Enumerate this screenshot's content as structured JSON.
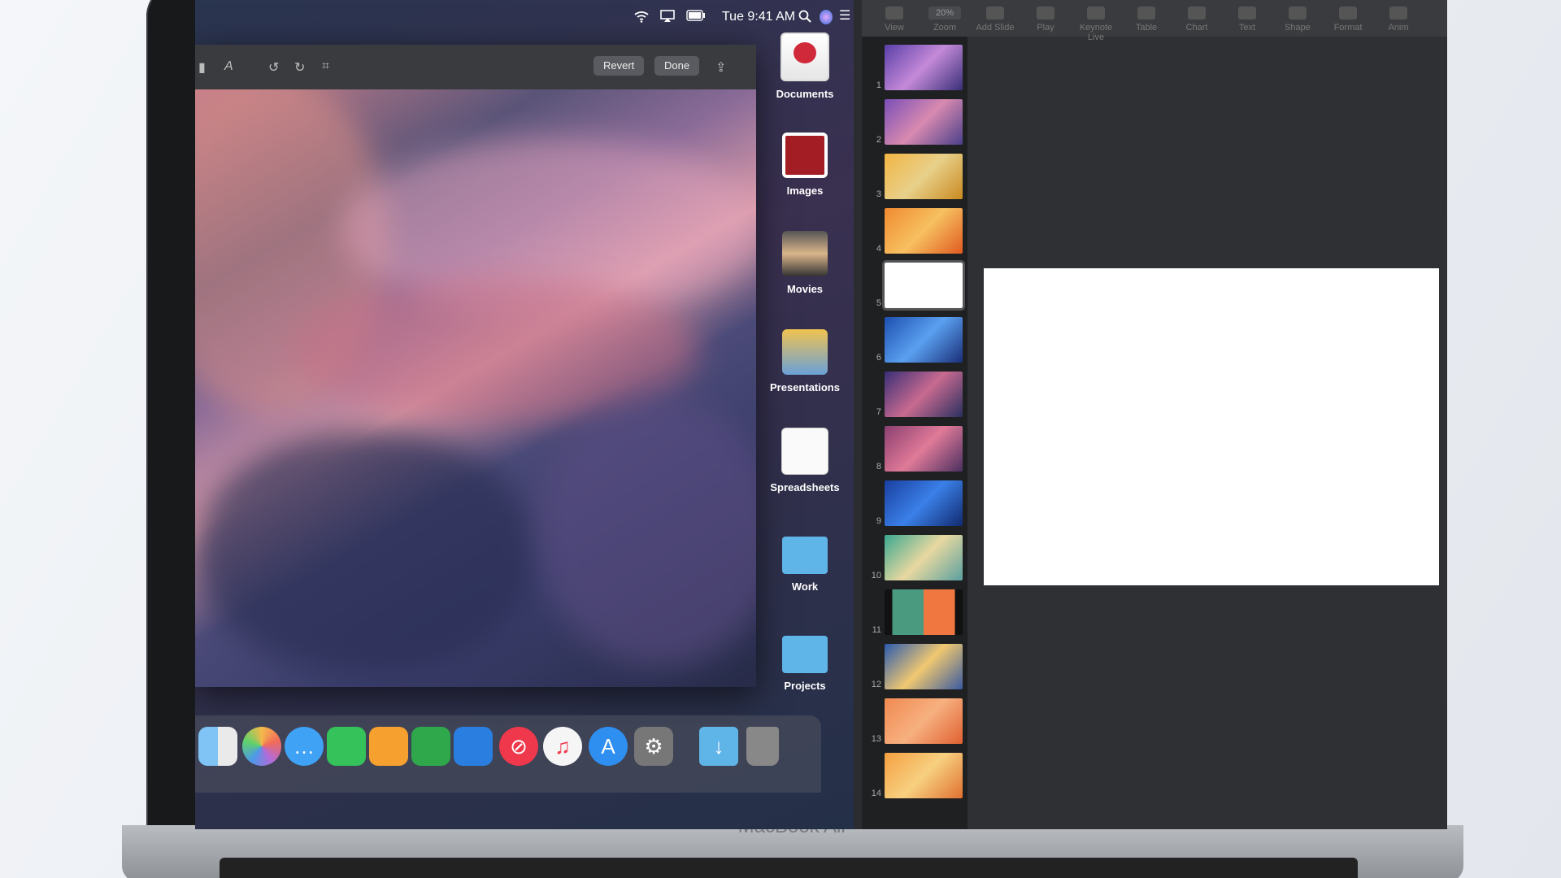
{
  "menubar": {
    "time": "Tue 9:41 AM",
    "icons": [
      "wifi-icon",
      "airplay-icon",
      "battery-icon",
      "search-icon",
      "siri-icon",
      "control-center-icon"
    ]
  },
  "editor": {
    "revert_label": "Revert",
    "done_label": "Done",
    "toolbar_icons": [
      "markup-icon",
      "text-style-icon",
      "rotate-left-icon",
      "rotate-right-icon",
      "crop-icon",
      "share-icon"
    ]
  },
  "stacks": [
    {
      "label": "Documents"
    },
    {
      "label": "Images"
    },
    {
      "label": "Movies"
    },
    {
      "label": "Presentations"
    },
    {
      "label": "Spreadsheets"
    },
    {
      "label": "Work"
    },
    {
      "label": "Projects"
    }
  ],
  "dock": {
    "apps": [
      "finder-icon",
      "photos-icon",
      "messages-icon",
      "facetime-icon",
      "pages-icon",
      "numbers-icon",
      "keynote-icon",
      "news-icon",
      "music-icon",
      "app-store-icon",
      "system-preferences-icon",
      "downloads-folder-icon",
      "trash-icon"
    ]
  },
  "keynote": {
    "toolbar": [
      {
        "label": "View"
      },
      {
        "label": "Zoom",
        "value": "20%"
      },
      {
        "label": "Add Slide"
      },
      {
        "label": "Play"
      },
      {
        "label": "Keynote Live"
      },
      {
        "label": "Table"
      },
      {
        "label": "Chart"
      },
      {
        "label": "Text"
      },
      {
        "label": "Shape"
      },
      {
        "label": "Format"
      },
      {
        "label": "Anim"
      }
    ],
    "slides": [
      "1",
      "2",
      "3",
      "4",
      "5",
      "6",
      "7",
      "8",
      "9",
      "10",
      "11",
      "12",
      "13",
      "14"
    ],
    "selected_slide": "5"
  },
  "device": {
    "brand": "MacBook Air"
  },
  "colors": {
    "accent": "#3a8ee6",
    "folder": "#5fb4e8"
  }
}
